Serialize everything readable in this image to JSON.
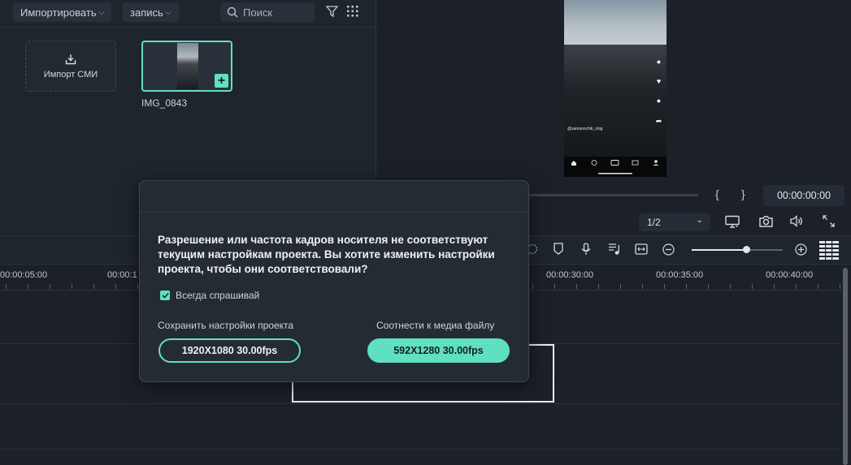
{
  "media_toolbar": {
    "import_label": "Импортировать",
    "record_label": "запись",
    "search_placeholder": "Поиск"
  },
  "media": {
    "import_tile_label": "Импорт СМИ",
    "clip_name": "IMG_0843"
  },
  "preview": {
    "handle": "@samsonchik_vlog",
    "timecode": "00:00:00:00",
    "zoom": "1/2",
    "mark_in": "{",
    "mark_out": "}"
  },
  "timeline": {
    "ticks": [
      "00:00:05:00",
      "00:00:1",
      "00:00:30:00",
      "00:00:35:00",
      "00:00:40:00"
    ]
  },
  "dialog": {
    "message": "Разрешение или частота кадров носителя не соответствуют текущим настройкам проекта. Вы хотите изменить настройки проекта, чтобы они соответствовали?",
    "always_ask_label": "Всегда спрашивай",
    "always_ask_checked": true,
    "keep_label": "Сохранить настройки проекта",
    "keep_button": "1920X1080  30.00fps",
    "match_label": "Соотнести к медиа файлу",
    "match_button": "592X1280  30.00fps"
  },
  "colors": {
    "accent": "#5fe0c1",
    "panel": "#1f252d",
    "dialog": "#252b33"
  }
}
